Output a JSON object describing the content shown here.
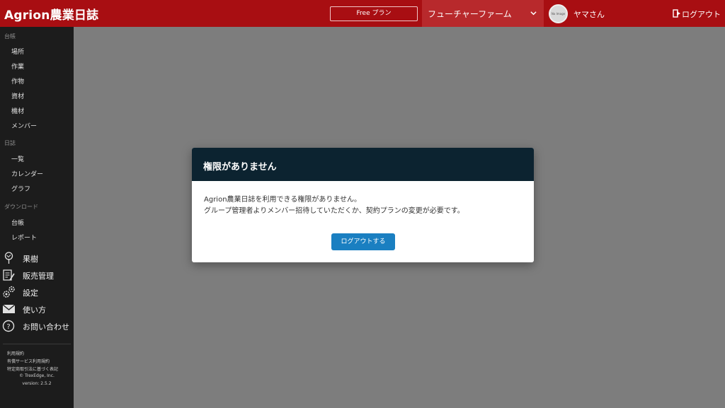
{
  "header": {
    "logo": "Agrion農業日誌",
    "plan_label": "Free プラン",
    "farm_name": "フューチャーファーム",
    "avatar_text": "No Image",
    "user_name": "ヤマさん",
    "logout_label": "ログアウト"
  },
  "sidebar": {
    "section_ledger": "台帳",
    "ledger_items": [
      "場所",
      "作業",
      "作物",
      "資材",
      "機材",
      "メンバー"
    ],
    "section_diary": "日誌",
    "diary_items": [
      "一覧",
      "カレンダー",
      "グラフ"
    ],
    "section_download": "ダウンロード",
    "download_items": [
      "台帳",
      "レポート"
    ],
    "big_items": [
      {
        "label": "果樹",
        "icon": "tree-icon"
      },
      {
        "label": "販売管理",
        "icon": "clipboard-pencil-icon"
      },
      {
        "label": "設定",
        "icon": "gear-icon"
      },
      {
        "label": "使い方",
        "icon": "envelope-icon"
      },
      {
        "label": "お問い合わせ",
        "icon": "question-circle-icon"
      }
    ],
    "footer": {
      "terms": "利用規約",
      "service_terms": "有償サービス利用規約",
      "commerce_law": "特定商取引法に基づく表記",
      "copyright": "© TrexEdge, Inc.",
      "version": "version: 2.5.2"
    }
  },
  "modal": {
    "title": "権限がありません",
    "line1": "Agrion農業日誌を利用できる権限がありません。",
    "line2": "グループ管理者よりメンバー招待していただくか、契約プランの変更が必要です。",
    "button_label": "ログアウトする"
  },
  "colors": {
    "header_bg": "#a80e12",
    "sidebar_bg": "#1c1c1c",
    "modal_header_bg": "#0c2330",
    "primary_button": "#1a7fc1",
    "overlay": "#7d7d7d"
  }
}
